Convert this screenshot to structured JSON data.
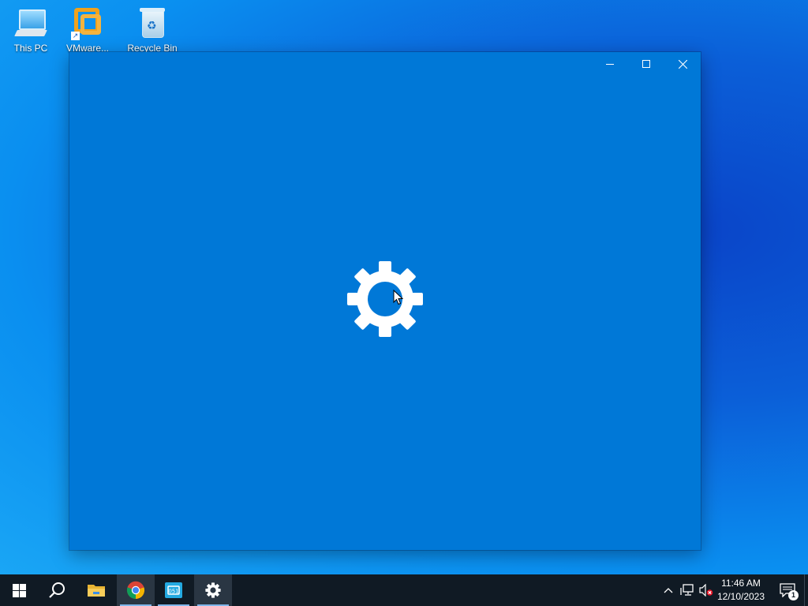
{
  "desktop": {
    "icons": [
      {
        "label": "This PC",
        "icon": "computer-icon"
      },
      {
        "label": "VMware...",
        "icon": "vmware-icon"
      },
      {
        "label": "Recycle Bin",
        "icon": "recycle-bin-icon"
      }
    ]
  },
  "window": {
    "app": "Settings",
    "splash_icon": "gear-icon",
    "background": "#0078d7",
    "controls": [
      "minimize",
      "maximize",
      "close"
    ]
  },
  "taskbar": {
    "apps": [
      {
        "name": "start",
        "icon": "windows-logo-icon"
      },
      {
        "name": "search",
        "icon": "search-icon"
      },
      {
        "name": "file-explorer",
        "icon": "folder-icon"
      },
      {
        "name": "chrome",
        "icon": "chrome-icon"
      },
      {
        "name": "app-051",
        "icon": "app-icon"
      },
      {
        "name": "settings",
        "icon": "gear-icon"
      }
    ],
    "clock": {
      "time": "11:46 AM",
      "date": "12/10/2023"
    },
    "notification_count": "1"
  },
  "colors": {
    "accent": "#0078d7",
    "taskbar": "#101a24"
  }
}
